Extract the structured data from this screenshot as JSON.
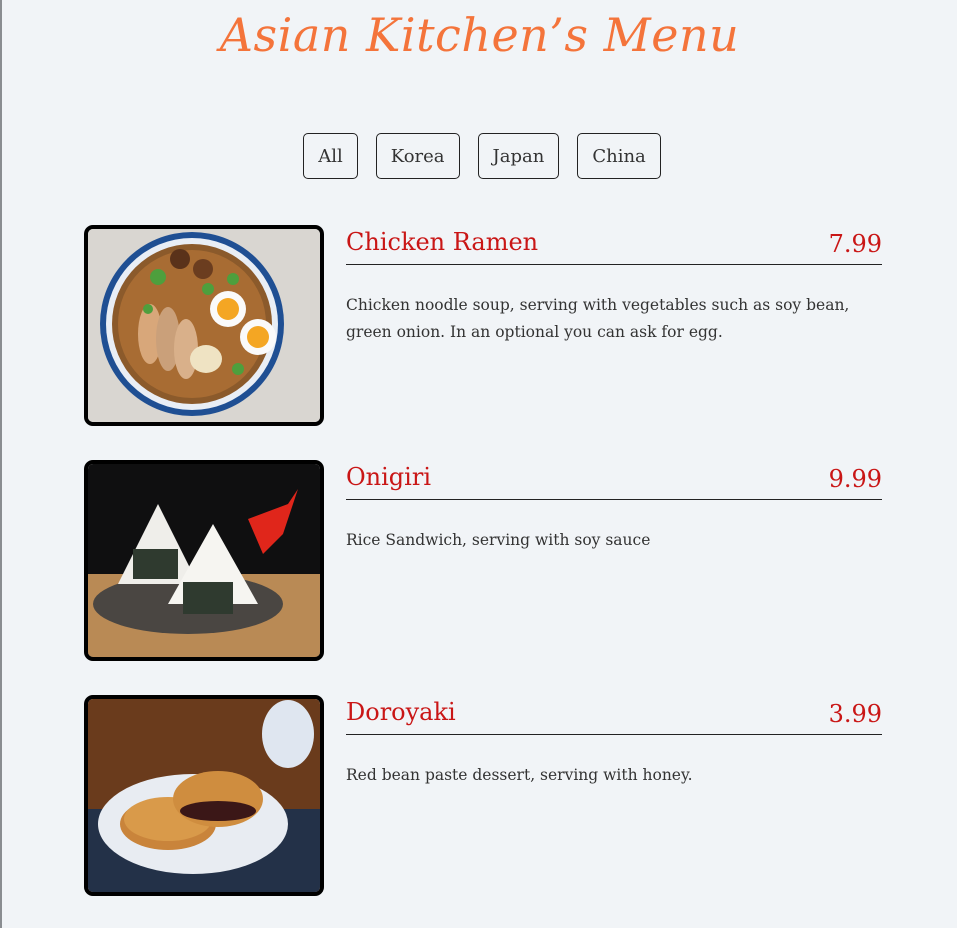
{
  "header": {
    "title": "Asian Kitchen’s Menu"
  },
  "filters": [
    {
      "label": "All"
    },
    {
      "label": "Korea"
    },
    {
      "label": "Japan"
    },
    {
      "label": "China"
    }
  ],
  "items": [
    {
      "name": "Chicken Ramen",
      "price": "7.99",
      "description": "Chicken noodle soup, serving with vegetables such as soy bean, green onion. In an optional you can ask for egg.",
      "image": "chicken-ramen-photo"
    },
    {
      "name": "Onigiri",
      "price": "9.99",
      "description": "Rice Sandwich, serving with soy sauce",
      "image": "onigiri-photo"
    },
    {
      "name": "Doroyaki",
      "price": "3.99",
      "description": "Red bean paste dessert, serving with honey.",
      "image": "doroyaki-photo"
    }
  ],
  "colors": {
    "title": "#f4743b",
    "item_text": "#c91616",
    "background": "#f1f4f7"
  }
}
